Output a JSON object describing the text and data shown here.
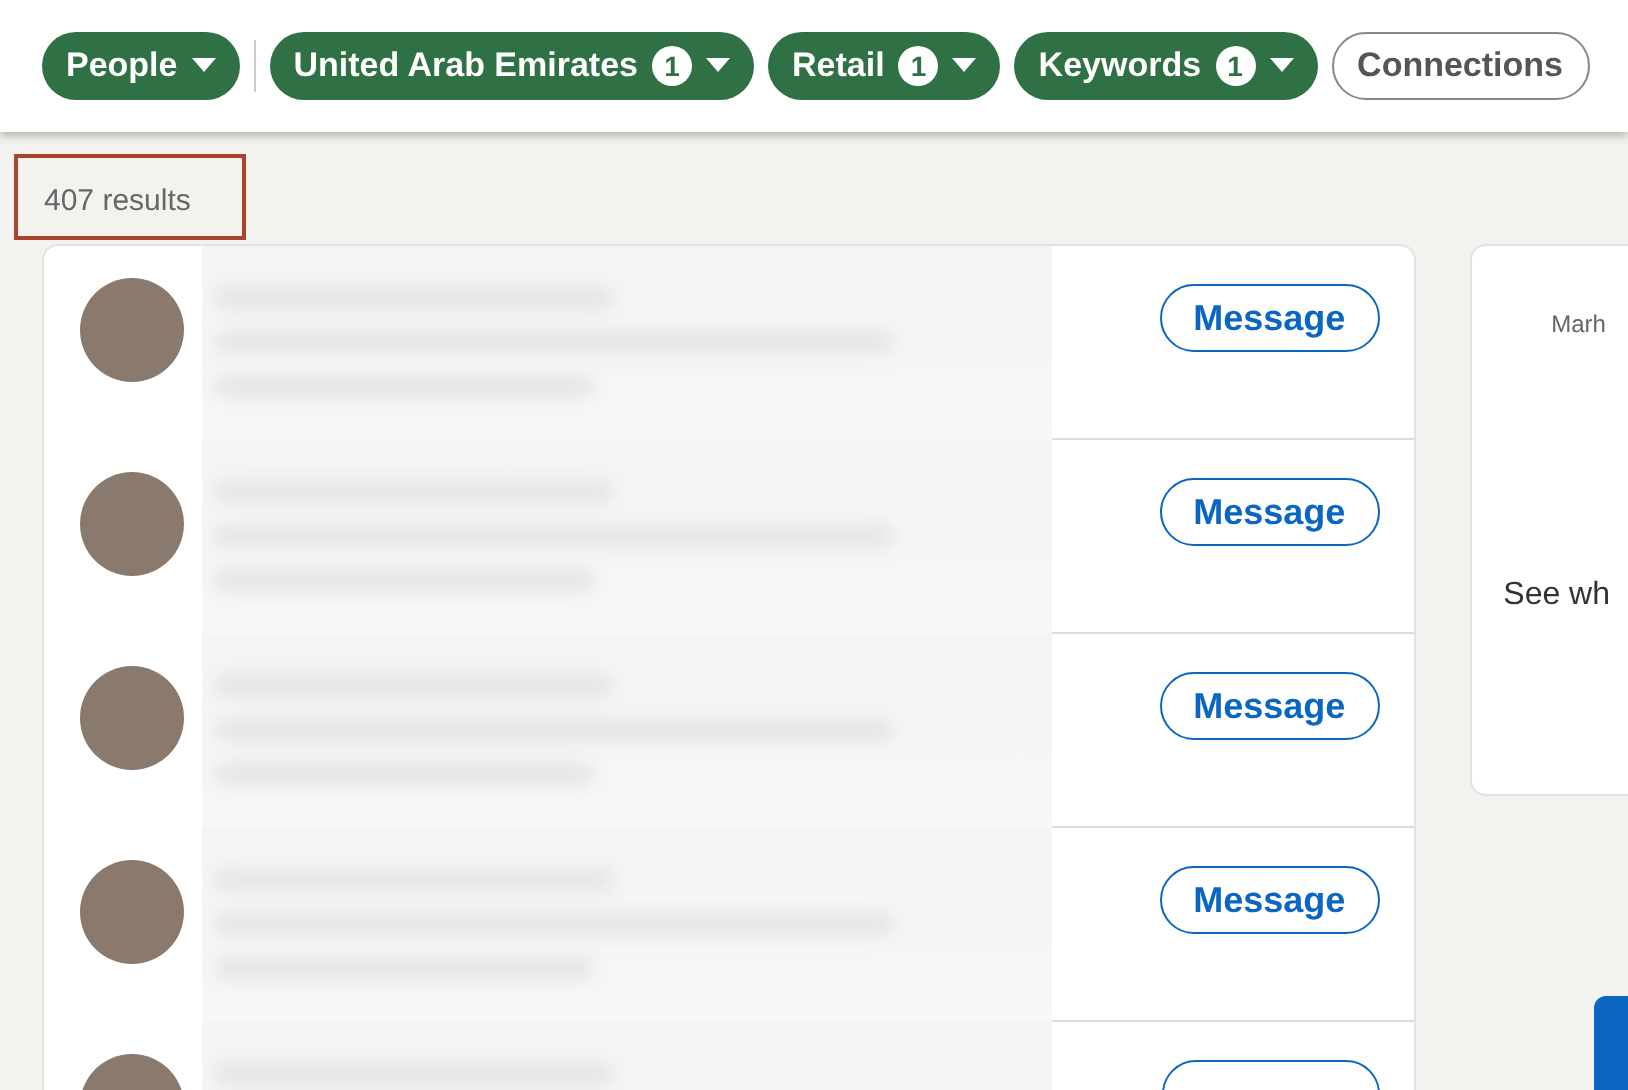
{
  "filters": [
    {
      "label": "People",
      "selected": true
    },
    {
      "label": "United Arab Emirates",
      "count": "1",
      "selected": true
    },
    {
      "label": "Retail",
      "count": "1",
      "selected": true
    },
    {
      "label": "Keywords",
      "count": "1",
      "selected": true
    },
    {
      "label": "Connections",
      "selected": false
    }
  ],
  "results_count": "407 results",
  "results": [
    {
      "button": "Message"
    },
    {
      "button": "Message"
    },
    {
      "button": "Message"
    },
    {
      "button": "Message"
    },
    {
      "kind": "cut_off"
    }
  ],
  "side_card": {
    "text_1": "Marh",
    "text_2": "See wh"
  }
}
